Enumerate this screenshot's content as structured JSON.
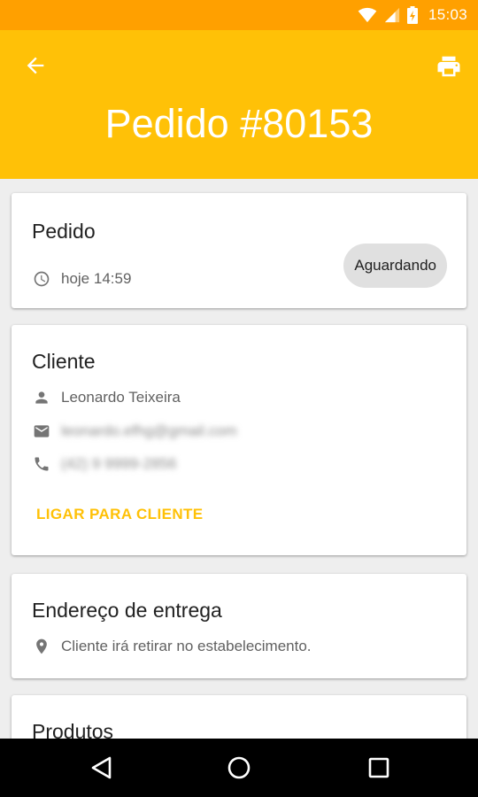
{
  "status_bar": {
    "time": "15:03"
  },
  "app_bar": {
    "title": "Pedido #80153"
  },
  "order_card": {
    "heading": "Pedido",
    "time": "hoje 14:59",
    "status": "Aguardando"
  },
  "client_card": {
    "heading": "Cliente",
    "name": "Leonardo Teixeira",
    "email": "leonardo.efhg@gmail.com",
    "phone": "(42) 9 9999-2856",
    "call_label": "LIGAR PARA CLIENTE"
  },
  "address_card": {
    "heading": "Endereço de entrega",
    "address": "Cliente irá retirar no estabelecimento."
  },
  "products_card": {
    "heading": "Produtos"
  },
  "colors": {
    "primary": "#FFC107",
    "primary_dark": "#FFA000"
  },
  "icons": {
    "back": "arrow-left-icon",
    "print": "printer-icon",
    "clock": "clock-icon",
    "person": "person-icon",
    "email": "email-icon",
    "phone": "phone-icon",
    "location": "location-pin-icon"
  }
}
